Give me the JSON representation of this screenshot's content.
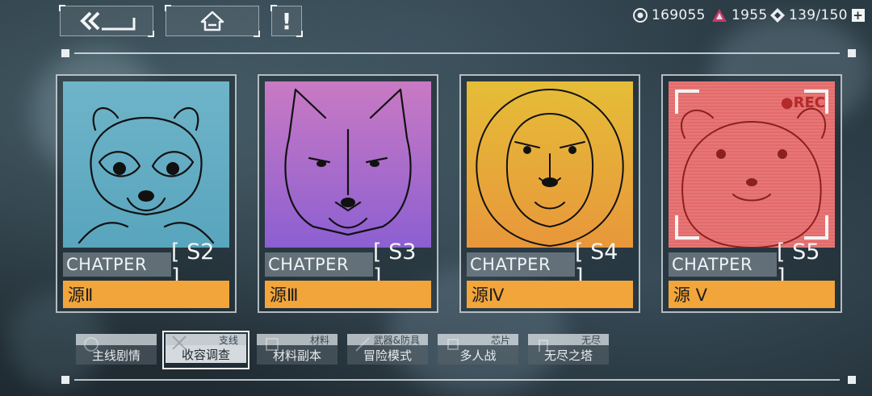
{
  "resources": {
    "coins": "169055",
    "crystals": "1955",
    "energy": "139/150",
    "energy_add": "+"
  },
  "nav": {
    "alert": "!"
  },
  "cards": [
    {
      "animal": "raccoon",
      "chapter_label": "CHATPER",
      "chapter_num": "[ S2 ]",
      "source": "源Ⅱ",
      "bg_top": "#6fb4c9",
      "bg_bottom": "#5aa6c0"
    },
    {
      "animal": "wolf",
      "chapter_label": "CHATPER",
      "chapter_num": "[ S3 ]",
      "source": "源Ⅲ",
      "bg_top": "#c97ac3",
      "bg_bottom": "#8f5fd0"
    },
    {
      "animal": "lion",
      "chapter_label": "CHATPER",
      "chapter_num": "[ S4 ]",
      "source": "源Ⅳ",
      "bg_top": "#e2b63a",
      "bg_bottom": "#e8983a"
    },
    {
      "animal": "hamster",
      "chapter_label": "CHATPER",
      "chapter_num": "[ S5 ]",
      "source": "源 Ⅴ",
      "bg_top": "#e4696a",
      "bg_bottom": "#e46a6a",
      "rec": "●REC"
    }
  ],
  "tabs": [
    {
      "top": "",
      "label": "主线剧情",
      "active": false
    },
    {
      "top": "支线",
      "label": "收容调查",
      "active": true
    },
    {
      "top": "材料",
      "label": "材料副本",
      "active": false
    },
    {
      "top": "武器&防具",
      "label": "冒险模式",
      "active": false
    },
    {
      "top": "芯片",
      "label": "多人战",
      "active": false
    },
    {
      "top": "无尽",
      "label": "无尽之塔",
      "active": false
    }
  ],
  "colors": {
    "accent": "#f2a53b",
    "panel_line": "#e1e8ec"
  }
}
